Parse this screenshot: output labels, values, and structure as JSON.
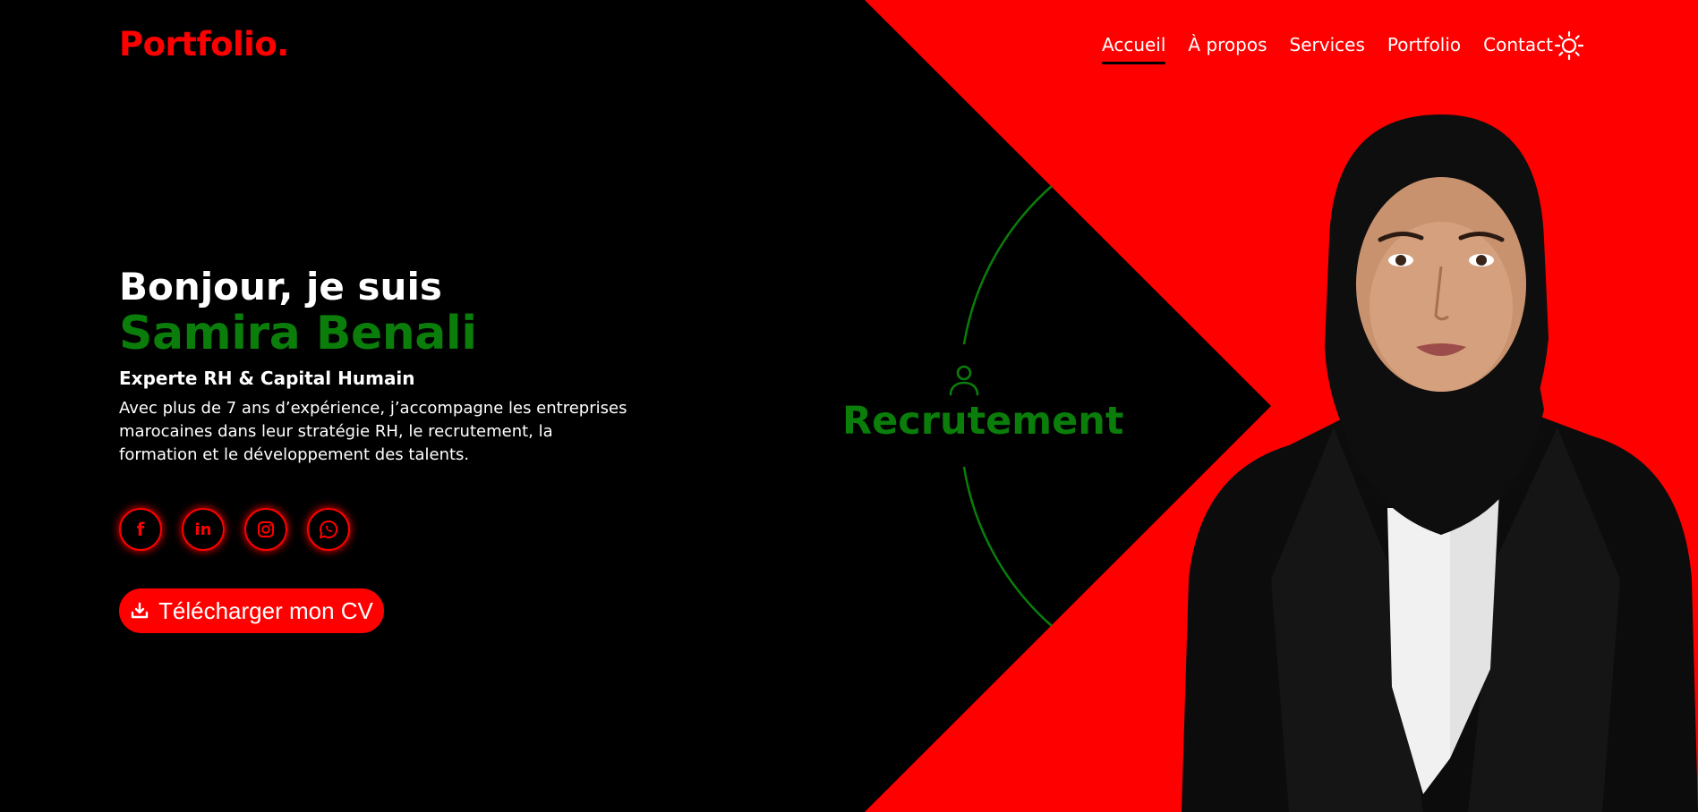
{
  "header": {
    "logo": "Portfolio.",
    "nav": [
      {
        "label": "Accueil",
        "active": true
      },
      {
        "label": "À propos",
        "active": false
      },
      {
        "label": "Services",
        "active": false
      },
      {
        "label": "Portfolio",
        "active": false
      },
      {
        "label": "Contact",
        "active": false
      }
    ],
    "theme_icon": "sun-icon"
  },
  "hero": {
    "greeting": "Bonjour, je suis",
    "name": "Samira Benali",
    "role": "Experte RH & Capital Humain",
    "description": "Avec plus de 7 ans d’expérience, j’accompagne les entreprises marocaines dans leur stratégie RH, le recrutement, la formation et le développement des talents.",
    "socials": [
      {
        "icon": "facebook-icon",
        "label": "f"
      },
      {
        "icon": "linkedin-icon",
        "label": "in"
      },
      {
        "icon": "instagram-icon"
      },
      {
        "icon": "whatsapp-icon"
      }
    ],
    "cv_button": "Télécharger mon CV"
  },
  "rotator": {
    "label": "Recrutement",
    "icon": "user-icon"
  },
  "colors": {
    "accent": "#ff0000",
    "highlight": "#0a7d0a",
    "background": "#000000"
  }
}
